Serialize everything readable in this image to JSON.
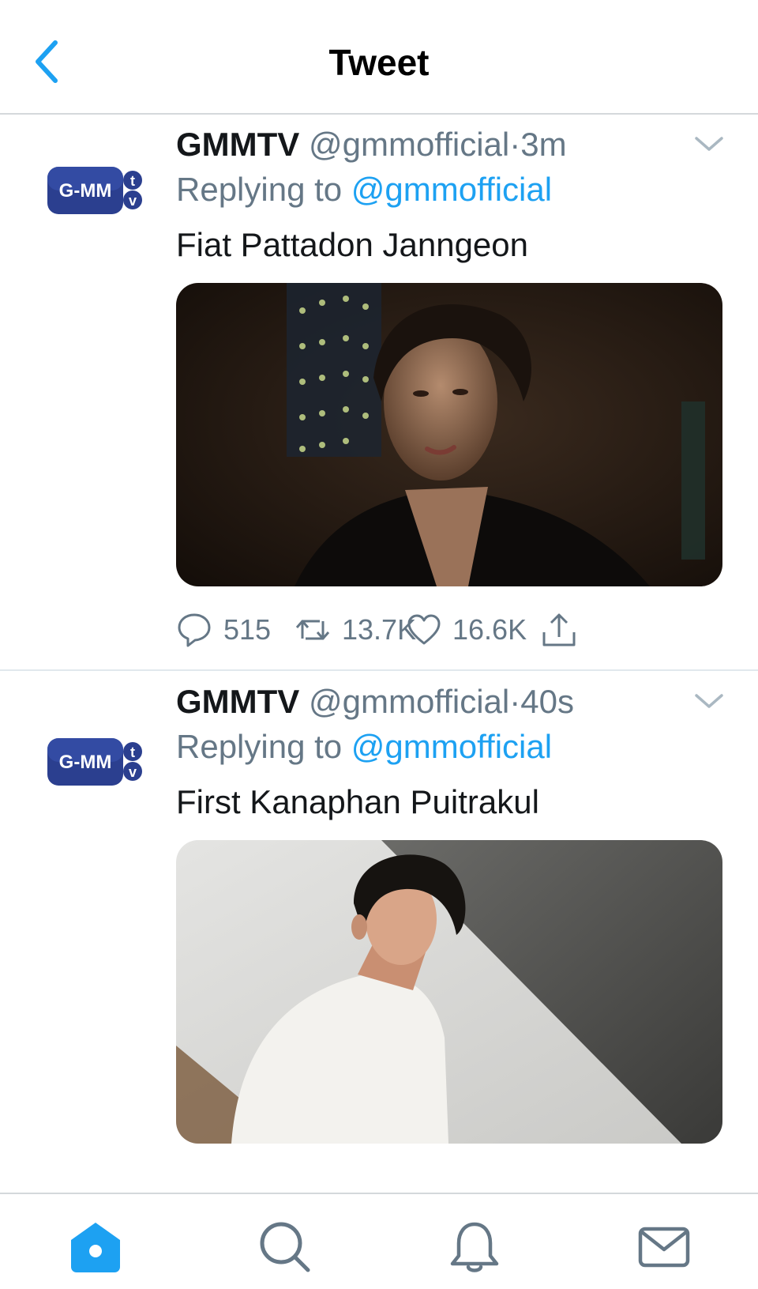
{
  "header": {
    "title": "Tweet",
    "back_icon": "chevron-left-icon"
  },
  "colors": {
    "accent": "#1da1f2",
    "secondary_text": "#657786",
    "primary_text": "#14171a"
  },
  "tweets": [
    {
      "name": "GMMTV",
      "handle": "@gmmofficial",
      "dot": "·",
      "time": "3m",
      "reply_prefix": "Replying to",
      "reply_to": "@gmmofficial",
      "text": "Fiat Pattadon Janngeon",
      "avatar": {
        "left": "G-MM",
        "right_top": "t",
        "right_bottom": "v"
      },
      "actions": {
        "replies": "515",
        "retweets": "13.7K",
        "likes": "16.6K"
      }
    },
    {
      "name": "GMMTV",
      "handle": "@gmmofficial",
      "dot": "·",
      "time": "40s",
      "reply_prefix": "Replying to",
      "reply_to": "@gmmofficial",
      "text": "First Kanaphan Puitrakul",
      "avatar": {
        "left": "G-MM",
        "right_top": "t",
        "right_bottom": "v"
      },
      "actions": {
        "replies": "",
        "retweets": "",
        "likes": ""
      }
    }
  ],
  "tabbar": {
    "items": [
      "home-icon",
      "search-icon",
      "notifications-bell-icon",
      "messages-envelope-icon"
    ],
    "active": "home-icon"
  }
}
